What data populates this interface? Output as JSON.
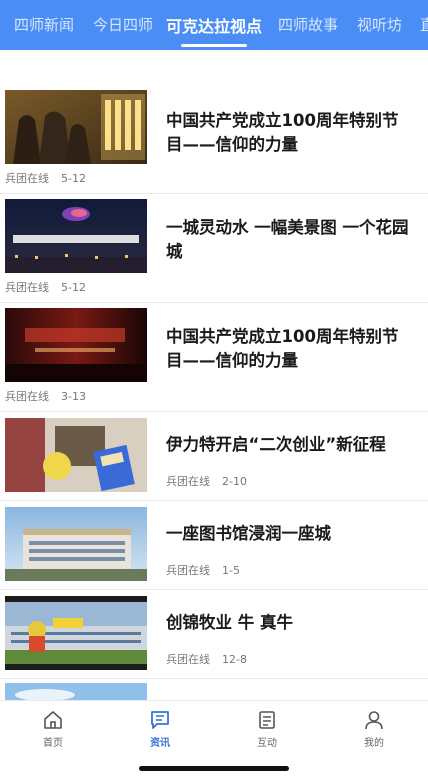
{
  "tabs": [
    {
      "label": "四师新闻"
    },
    {
      "label": "今日四师"
    },
    {
      "label": "可克达拉视点",
      "active": true
    },
    {
      "label": "四师故事"
    },
    {
      "label": "视听坊"
    },
    {
      "label": "直"
    }
  ],
  "articles": [
    {
      "title": "中国共产党成立100周年特别节目——信仰的力量",
      "source": "兵团在线",
      "date": "5-12"
    },
    {
      "title": "一城灵动水 一幅美景图 一个花园城",
      "source": "兵团在线",
      "date": "5-12"
    },
    {
      "title": "中国共产党成立100周年特别节目——信仰的力量",
      "source": "兵团在线",
      "date": "3-13"
    },
    {
      "title": "伊力特开启“二次创业”新征程",
      "source": "兵团在线",
      "date": "2-10"
    },
    {
      "title": "一座图书馆浸润一座城",
      "source": "兵团在线",
      "date": "1-5"
    },
    {
      "title": "创锦牧业 牛 真牛",
      "source": "兵团在线",
      "date": "12-8"
    }
  ],
  "bottom_nav": [
    {
      "label": "首页",
      "icon": "home-icon"
    },
    {
      "label": "资讯",
      "icon": "news-icon",
      "active": true
    },
    {
      "label": "互动",
      "icon": "interact-icon"
    },
    {
      "label": "我的",
      "icon": "user-icon"
    }
  ],
  "colors": {
    "accent": "#4a8ef5",
    "active_nav": "#3a74d8"
  }
}
